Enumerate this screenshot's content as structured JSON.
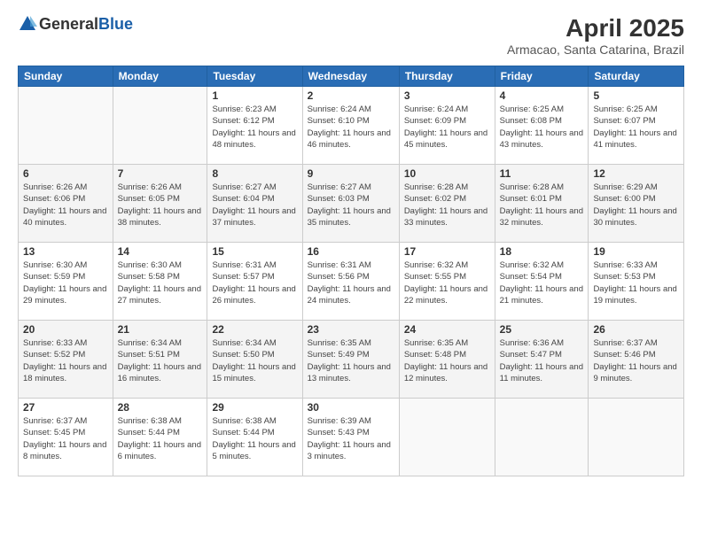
{
  "header": {
    "logo_general": "General",
    "logo_blue": "Blue",
    "month_year": "April 2025",
    "location": "Armacao, Santa Catarina, Brazil"
  },
  "days_of_week": [
    "Sunday",
    "Monday",
    "Tuesday",
    "Wednesday",
    "Thursday",
    "Friday",
    "Saturday"
  ],
  "weeks": [
    [
      {
        "day": "",
        "info": ""
      },
      {
        "day": "",
        "info": ""
      },
      {
        "day": "1",
        "info": "Sunrise: 6:23 AM\nSunset: 6:12 PM\nDaylight: 11 hours and 48 minutes."
      },
      {
        "day": "2",
        "info": "Sunrise: 6:24 AM\nSunset: 6:10 PM\nDaylight: 11 hours and 46 minutes."
      },
      {
        "day": "3",
        "info": "Sunrise: 6:24 AM\nSunset: 6:09 PM\nDaylight: 11 hours and 45 minutes."
      },
      {
        "day": "4",
        "info": "Sunrise: 6:25 AM\nSunset: 6:08 PM\nDaylight: 11 hours and 43 minutes."
      },
      {
        "day": "5",
        "info": "Sunrise: 6:25 AM\nSunset: 6:07 PM\nDaylight: 11 hours and 41 minutes."
      }
    ],
    [
      {
        "day": "6",
        "info": "Sunrise: 6:26 AM\nSunset: 6:06 PM\nDaylight: 11 hours and 40 minutes."
      },
      {
        "day": "7",
        "info": "Sunrise: 6:26 AM\nSunset: 6:05 PM\nDaylight: 11 hours and 38 minutes."
      },
      {
        "day": "8",
        "info": "Sunrise: 6:27 AM\nSunset: 6:04 PM\nDaylight: 11 hours and 37 minutes."
      },
      {
        "day": "9",
        "info": "Sunrise: 6:27 AM\nSunset: 6:03 PM\nDaylight: 11 hours and 35 minutes."
      },
      {
        "day": "10",
        "info": "Sunrise: 6:28 AM\nSunset: 6:02 PM\nDaylight: 11 hours and 33 minutes."
      },
      {
        "day": "11",
        "info": "Sunrise: 6:28 AM\nSunset: 6:01 PM\nDaylight: 11 hours and 32 minutes."
      },
      {
        "day": "12",
        "info": "Sunrise: 6:29 AM\nSunset: 6:00 PM\nDaylight: 11 hours and 30 minutes."
      }
    ],
    [
      {
        "day": "13",
        "info": "Sunrise: 6:30 AM\nSunset: 5:59 PM\nDaylight: 11 hours and 29 minutes."
      },
      {
        "day": "14",
        "info": "Sunrise: 6:30 AM\nSunset: 5:58 PM\nDaylight: 11 hours and 27 minutes."
      },
      {
        "day": "15",
        "info": "Sunrise: 6:31 AM\nSunset: 5:57 PM\nDaylight: 11 hours and 26 minutes."
      },
      {
        "day": "16",
        "info": "Sunrise: 6:31 AM\nSunset: 5:56 PM\nDaylight: 11 hours and 24 minutes."
      },
      {
        "day": "17",
        "info": "Sunrise: 6:32 AM\nSunset: 5:55 PM\nDaylight: 11 hours and 22 minutes."
      },
      {
        "day": "18",
        "info": "Sunrise: 6:32 AM\nSunset: 5:54 PM\nDaylight: 11 hours and 21 minutes."
      },
      {
        "day": "19",
        "info": "Sunrise: 6:33 AM\nSunset: 5:53 PM\nDaylight: 11 hours and 19 minutes."
      }
    ],
    [
      {
        "day": "20",
        "info": "Sunrise: 6:33 AM\nSunset: 5:52 PM\nDaylight: 11 hours and 18 minutes."
      },
      {
        "day": "21",
        "info": "Sunrise: 6:34 AM\nSunset: 5:51 PM\nDaylight: 11 hours and 16 minutes."
      },
      {
        "day": "22",
        "info": "Sunrise: 6:34 AM\nSunset: 5:50 PM\nDaylight: 11 hours and 15 minutes."
      },
      {
        "day": "23",
        "info": "Sunrise: 6:35 AM\nSunset: 5:49 PM\nDaylight: 11 hours and 13 minutes."
      },
      {
        "day": "24",
        "info": "Sunrise: 6:35 AM\nSunset: 5:48 PM\nDaylight: 11 hours and 12 minutes."
      },
      {
        "day": "25",
        "info": "Sunrise: 6:36 AM\nSunset: 5:47 PM\nDaylight: 11 hours and 11 minutes."
      },
      {
        "day": "26",
        "info": "Sunrise: 6:37 AM\nSunset: 5:46 PM\nDaylight: 11 hours and 9 minutes."
      }
    ],
    [
      {
        "day": "27",
        "info": "Sunrise: 6:37 AM\nSunset: 5:45 PM\nDaylight: 11 hours and 8 minutes."
      },
      {
        "day": "28",
        "info": "Sunrise: 6:38 AM\nSunset: 5:44 PM\nDaylight: 11 hours and 6 minutes."
      },
      {
        "day": "29",
        "info": "Sunrise: 6:38 AM\nSunset: 5:44 PM\nDaylight: 11 hours and 5 minutes."
      },
      {
        "day": "30",
        "info": "Sunrise: 6:39 AM\nSunset: 5:43 PM\nDaylight: 11 hours and 3 minutes."
      },
      {
        "day": "",
        "info": ""
      },
      {
        "day": "",
        "info": ""
      },
      {
        "day": "",
        "info": ""
      }
    ]
  ]
}
